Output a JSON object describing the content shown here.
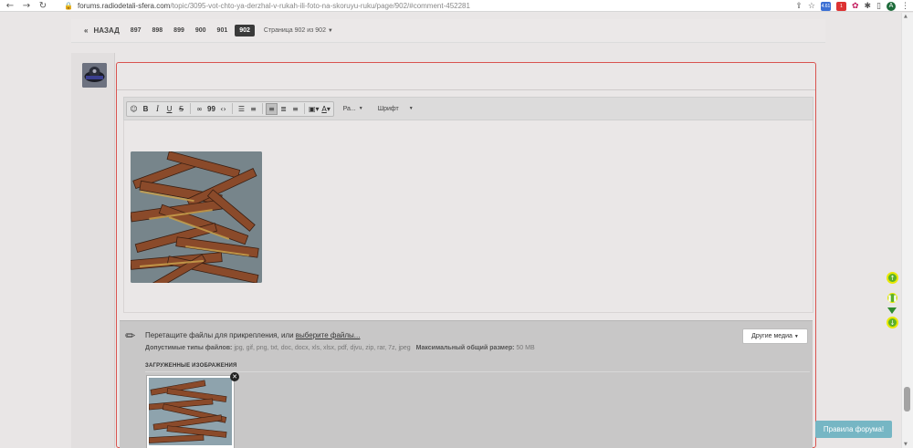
{
  "browser": {
    "url_host": "forums.radiodetali-sfera.com",
    "url_path": "/topic/3095-vot-chto-ya-derzhal-v-rukah-ili-foto-na-skoruyu-ruku/page/902/#comment-452281",
    "profile_initial": "A",
    "ext_badge_1": "4.61",
    "ext_badge_2": "1"
  },
  "pagination": {
    "prev_label": "НАЗАД",
    "pages": [
      "897",
      "898",
      "899",
      "900",
      "901",
      "902"
    ],
    "active_page": "902",
    "info": "Страница 902 из 902"
  },
  "toolbar": {
    "size_label": "Ра...",
    "font_label": "Шрифт"
  },
  "attachments": {
    "drop_text": "Перетащите файлы для прикрепления, или ",
    "drop_link": "выберите файлы...",
    "types_label": "Допустимые типы файлов:",
    "types_value": " jpg, gif, png, txt, doc, docx, xls, xlsx, pdf, djvu, zip, rar, 7z, jpeg",
    "max_label": "Максимальный общий размер:",
    "max_value": " 50 MB",
    "other_media": "Другие медиа",
    "uploaded_title": "ЗАГРУЖЕННЫЕ ИЗОБРАЖЕНИЯ"
  },
  "rules_button": "Правила форума!",
  "colors": {
    "editor_border": "#d9534f",
    "active_page_bg": "#3a3a3a",
    "rules_bg": "#76b6c4",
    "side_icon": "#5bb02a"
  }
}
